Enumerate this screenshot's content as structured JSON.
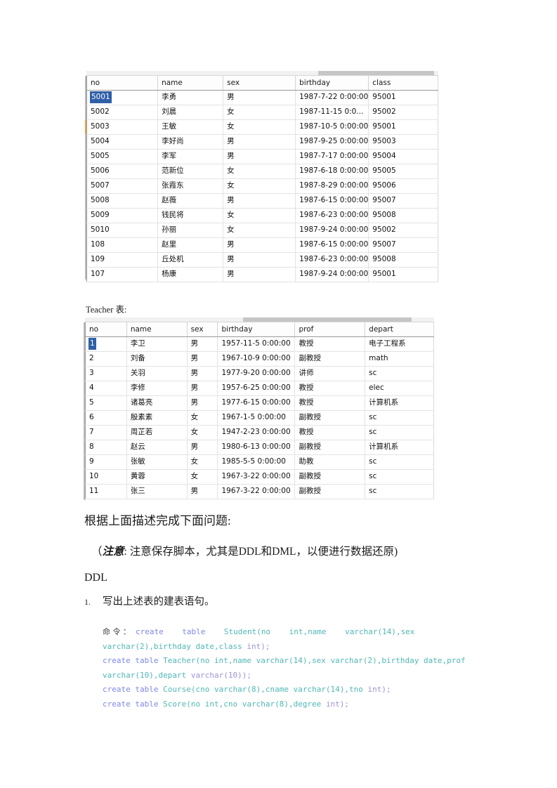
{
  "document": {
    "student_table": {
      "name": "Student",
      "columns": [
        "no",
        "name",
        "sex",
        "birthday",
        "class"
      ],
      "rows": [
        [
          "5001",
          "李勇",
          "男",
          "1987-7-22 0:00:00",
          "95001"
        ],
        [
          "5002",
          "刘晨",
          "女",
          "1987-11-15 0:0...",
          "95002"
        ],
        [
          "5003",
          "王敏",
          "女",
          "1987-10-5 0:00:00",
          "95001"
        ],
        [
          "5004",
          "李好尚",
          "男",
          "1987-9-25 0:00:00",
          "95003"
        ],
        [
          "5005",
          "李军",
          "男",
          "1987-7-17 0:00:00",
          "95004"
        ],
        [
          "5006",
          "范新位",
          "女",
          "1987-6-18 0:00:00",
          "95005"
        ],
        [
          "5007",
          "张霞东",
          "女",
          "1987-8-29 0:00:00",
          "95006"
        ],
        [
          "5008",
          "赵薇",
          "男",
          "1987-6-15 0:00:00",
          "95007"
        ],
        [
          "5009",
          "钱民将",
          "女",
          "1987-6-23 0:00:00",
          "95008"
        ],
        [
          "5010",
          "孙丽",
          "女",
          "1987-9-24 0:00:00",
          "95002"
        ],
        [
          "108",
          "赵里",
          "男",
          "1987-6-15 0:00:00",
          "95007"
        ],
        [
          "109",
          "丘处机",
          "男",
          "1987-6-23 0:00:00",
          "95008"
        ],
        [
          "107",
          "杨康",
          "男",
          "1987-9-24 0:00:00",
          "95001"
        ]
      ],
      "selected_cell": "5001"
    },
    "teacher_caption": "Teacher 表:",
    "teacher_table": {
      "name": "Teacher",
      "columns": [
        "no",
        "name",
        "sex",
        "birthday",
        "prof",
        "depart"
      ],
      "rows": [
        [
          "1",
          "李卫",
          "男",
          "1957-11-5 0:00:00",
          "教授",
          "电子工程系"
        ],
        [
          "2",
          "刘备",
          "男",
          "1967-10-9 0:00:00",
          "副教授",
          "math"
        ],
        [
          "3",
          "关羽",
          "男",
          "1977-9-20 0:00:00",
          "讲师",
          "sc"
        ],
        [
          "4",
          "李修",
          "男",
          "1957-6-25 0:00:00",
          "教授",
          "elec"
        ],
        [
          "5",
          "诸葛亮",
          "男",
          "1977-6-15 0:00:00",
          "教授",
          "计算机系"
        ],
        [
          "6",
          "殷素素",
          "女",
          "1967-1-5 0:00:00",
          "副教授",
          "sc"
        ],
        [
          "7",
          "周芷若",
          "女",
          "1947-2-23 0:00:00",
          "教授",
          "sc"
        ],
        [
          "8",
          "赵云",
          "男",
          "1980-6-13 0:00:00",
          "副教授",
          "计算机系"
        ],
        [
          "9",
          "张敏",
          "女",
          "1985-5-5 0:00:00",
          "助教",
          "sc"
        ],
        [
          "10",
          "黄蓉",
          "女",
          "1967-3-22 0:00:00",
          "副教授",
          "sc"
        ],
        [
          "11",
          "张三",
          "男",
          "1967-3-22 0:00:00",
          "副教授",
          "sc"
        ]
      ],
      "selected_cell": "1"
    },
    "lead_paragraph": "根据上面描述完成下面问题:",
    "note": {
      "open_paren": "（",
      "strong": "注意",
      "colon": ":",
      "text": "注意保存脚本，尤其是DDL和DML，以便进行数据还原)"
    },
    "heading_ddl": "DDL",
    "question_1": {
      "number": "1.",
      "text": "写出上述表的建表语句。"
    },
    "code_block": {
      "label": "命 令 ：",
      "lines": [
        "create    table    Student(no    int,name    varchar(14),sex varchar(2),birthday date,class int);",
        "create table Teacher(no int,name varchar(14),sex varchar(2),birthday date,prof varchar(10),depart varchar(10));",
        "create table Course(cno varchar(8),cname varchar(14),tno int);",
        "create table Score(no int,cno varchar(8),degree int);"
      ],
      "full_text": "命 令 ：  create    table    Student(no    int,name    varchar(14),sex varchar(2),birthday date,class int);\ncreate table Teacher(no int,name varchar(14),sex varchar(2),birthday date,prof varchar(10),depart varchar(10));\ncreate table Course(cno varchar(8),cname varchar(14),tno int);\ncreate table Score(no int,cno varchar(8),degree int);"
    }
  },
  "colors": {
    "selection_blue": "#2f5fa8",
    "row_marker_orange": "#e8a33d",
    "code_keyword": "#7d88e8",
    "code_identifier": "#4fb8b5",
    "code_type": "#9b95d6",
    "grid_header_border": "#9a9a9a",
    "grid_row_border": "#e3e3e3"
  }
}
